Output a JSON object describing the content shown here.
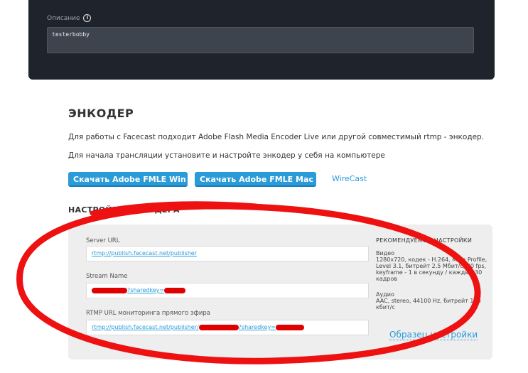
{
  "description": {
    "label": "Описание",
    "value": "testerbobby"
  },
  "encoder": {
    "title": "ЭНКОДЕР",
    "line1": "Для работы с Facecast подходит Adobe Flash Media Encoder Live или другой совместимый rtmp - энкодер.",
    "line2": "Для начала трансляции установите и настройте энкодер у себя на компьютере",
    "btn_win": "Скачать Adobe FMLE Win",
    "btn_mac": "Скачать Adobe FMLE Mac",
    "wirecast": "WireCast"
  },
  "settings": {
    "title": "НАСТРОЙКИ ЭНКОДЕРА",
    "server_url_label": "Server URL",
    "server_url": "rtmp://publish.facecast.net/publisher",
    "stream_name_label": "Stream Name",
    "stream_name_suffix": "?sharedkey=",
    "monitor_label": "RTMP URL мониторинга прямого эфира",
    "monitor_url_prefix": "rtmp://publish.facecast.net/publisher/",
    "monitor_url_mid": "?sharedkey=",
    "recommended_title": "РЕКОМЕНДУЕМЫЕ НАСТРОЙКИ",
    "video_label": "Видео",
    "video_text": "1280x720, кодек - H.264, Main Profile, Level 3.1, битрейт 2.5 Мбит/с, 30 fps, keyframe - 1 в секунду / каждые 30 кадров",
    "audio_label": "Аудио",
    "audio_text": "AAC, stereo, 44100 Hz, битрейт 128 кбит/с",
    "sample_link": "Образец настройки"
  },
  "colors": {
    "accent": "#2a9bd9",
    "dark_panel": "#1f242c",
    "redaction": "#e00000"
  }
}
